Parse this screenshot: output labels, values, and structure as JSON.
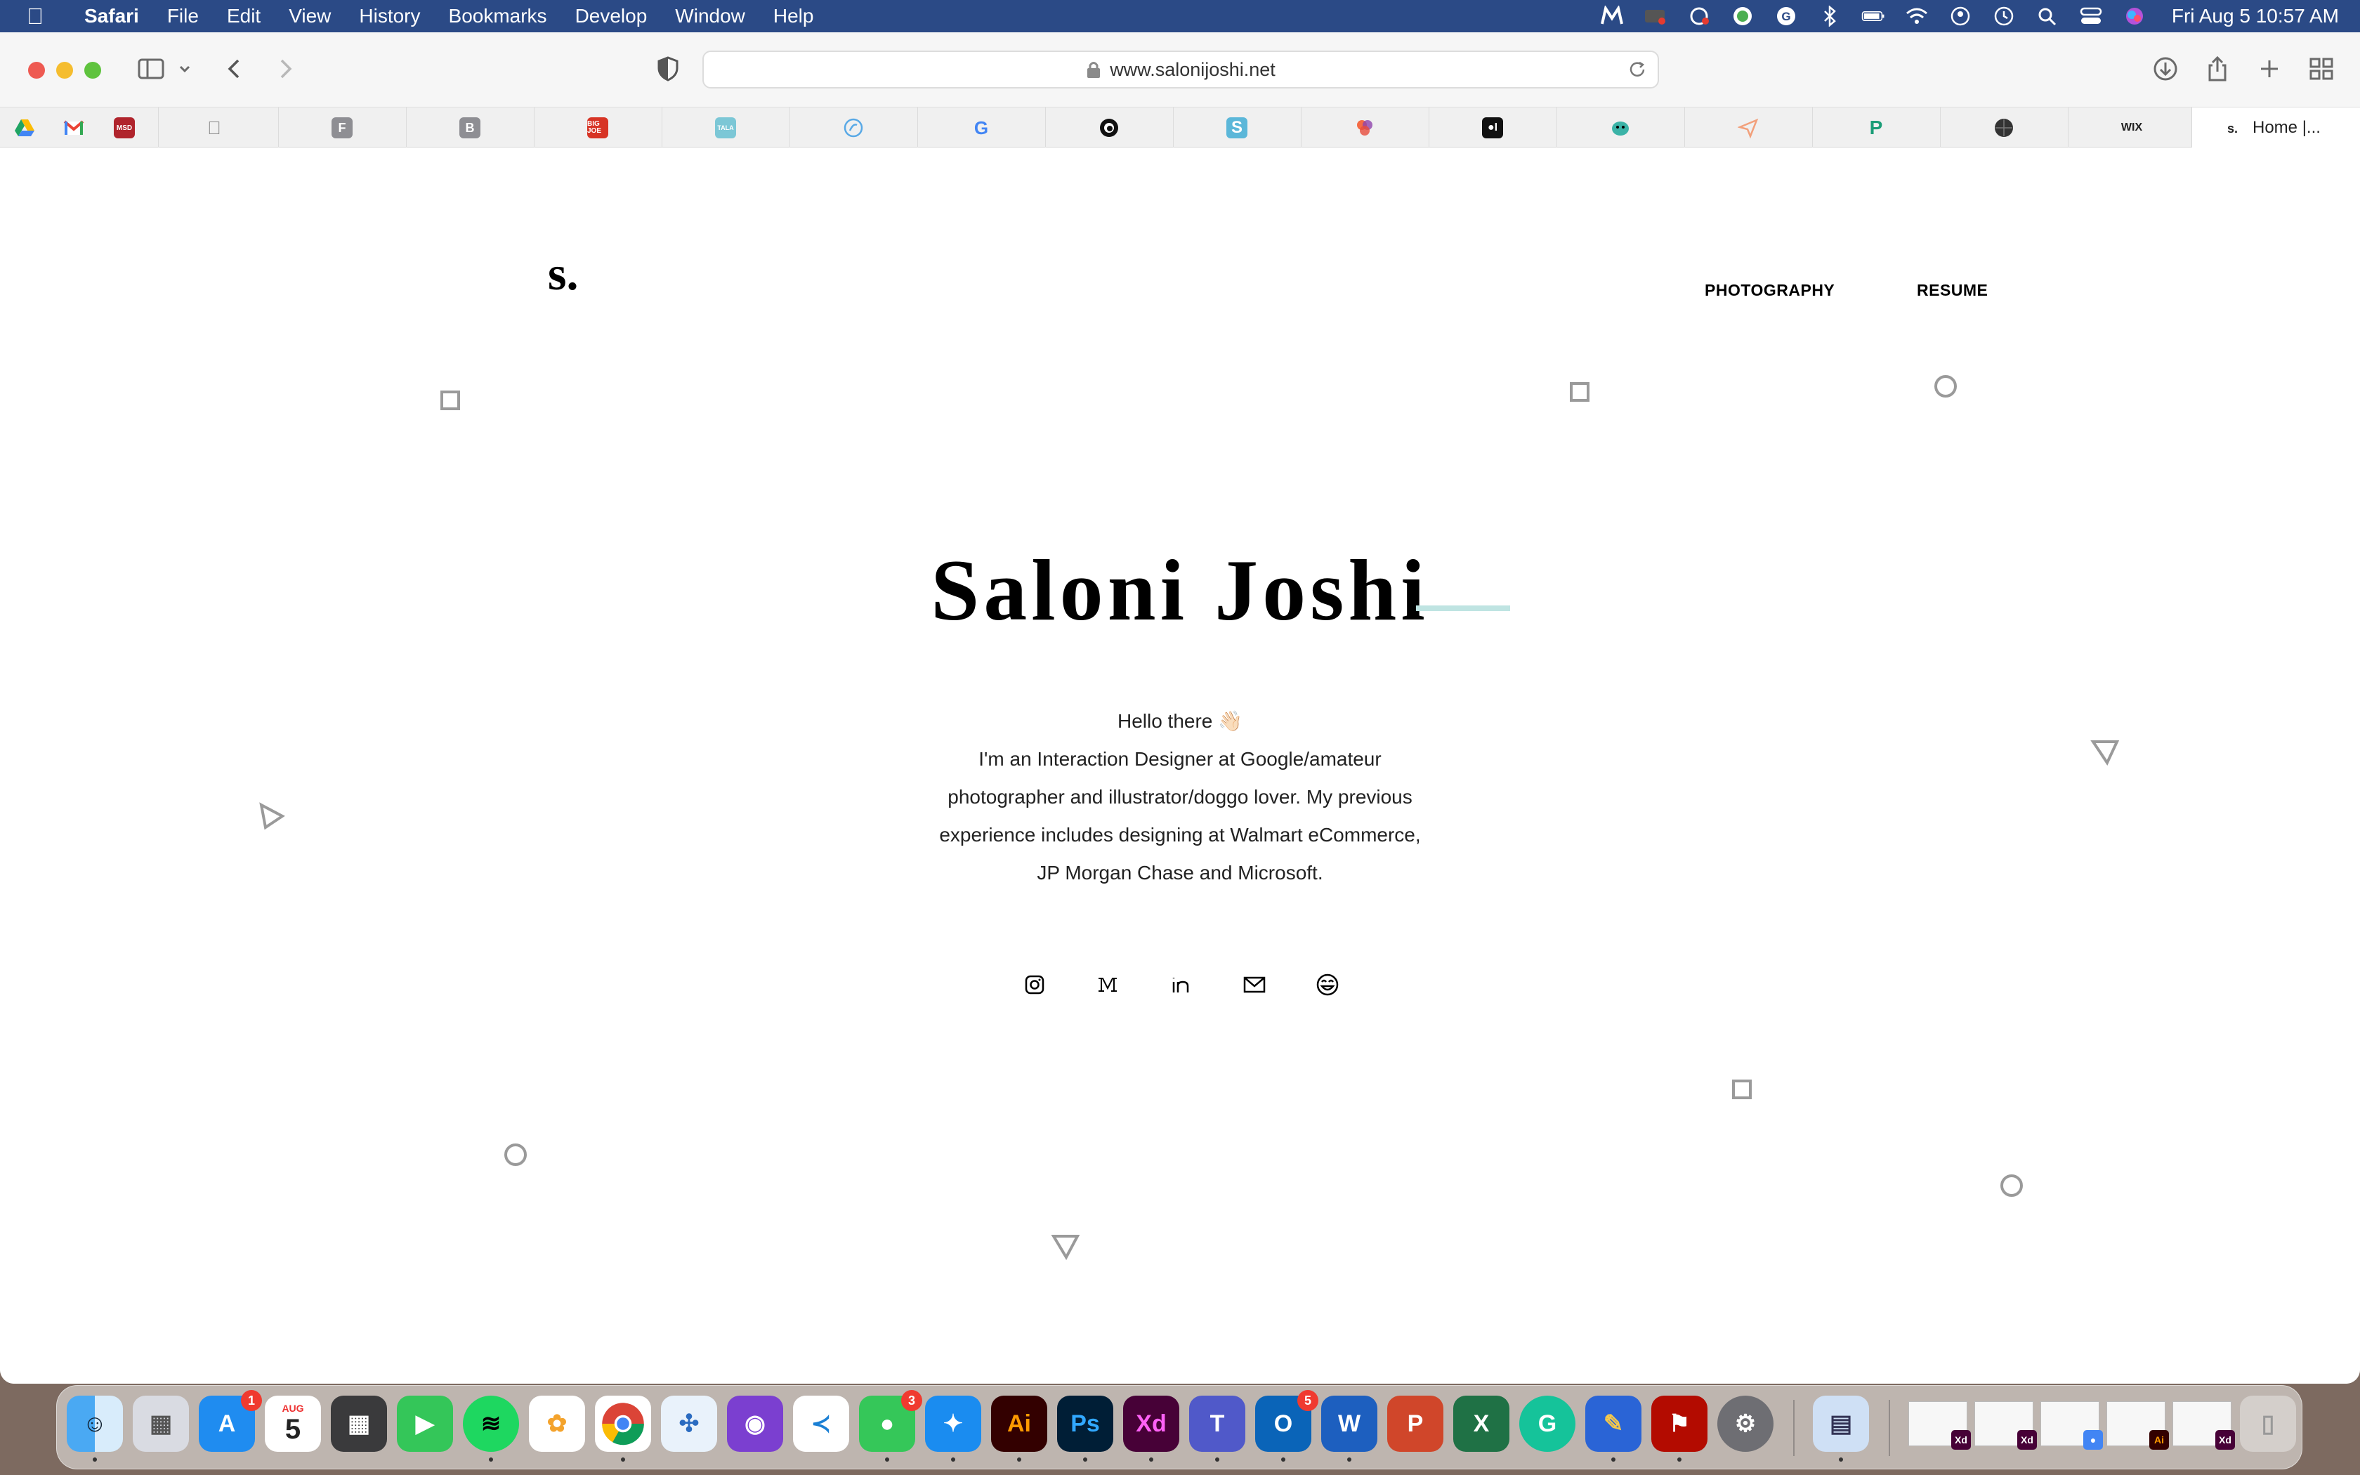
{
  "menubar": {
    "apple_icon": "apple-icon",
    "items": [
      "Safari",
      "File",
      "Edit",
      "View",
      "History",
      "Bookmarks",
      "Develop",
      "Window",
      "Help"
    ],
    "datetime": "Fri Aug 5  10:57 AM"
  },
  "browser": {
    "url": "www.salonijoshi.net",
    "favorites": [
      "google-drive",
      "gmail",
      "apple",
      "F",
      "B",
      "BIG JOE",
      "google",
      "s",
      "WIX"
    ],
    "active_tab": "Home |...",
    "active_tab_icon": "s."
  },
  "site": {
    "logo": "s.",
    "nav": [
      "PHOTOGRAPHY",
      "RESUME"
    ],
    "title": "Saloni Joshi",
    "greeting": "Hello there 👋🏻",
    "bio_lines": [
      "I'm an Interaction Designer at Google/amateur",
      "photographer and illustrator/doggo lover. My previous",
      "experience includes designing at Walmart eCommerce,",
      "JP Morgan Chase and Microsoft."
    ],
    "social": [
      "instagram-icon",
      "medium-icon",
      "linkedin-icon",
      "email-icon",
      "smiley-icon"
    ]
  },
  "dock": {
    "apps": [
      "Finder",
      "Launchpad",
      "App Store",
      "Calendar",
      "Calculator",
      "FaceTime",
      "Spotify",
      "Photos",
      "Chrome",
      "Grid",
      "GitHub",
      "VS Code",
      "Messages",
      "Safari",
      "Illustrator",
      "Photoshop",
      "XD",
      "Teams",
      "Outlook",
      "Word",
      "PowerPoint",
      "Excel",
      "Grammarly",
      "Pencil",
      "Acrobat",
      "System Preferences",
      "Preview"
    ],
    "calendar_month": "AUG",
    "calendar_day": "5",
    "badges": {
      "app_store": "1",
      "messages": "3",
      "outlook": "5"
    }
  }
}
